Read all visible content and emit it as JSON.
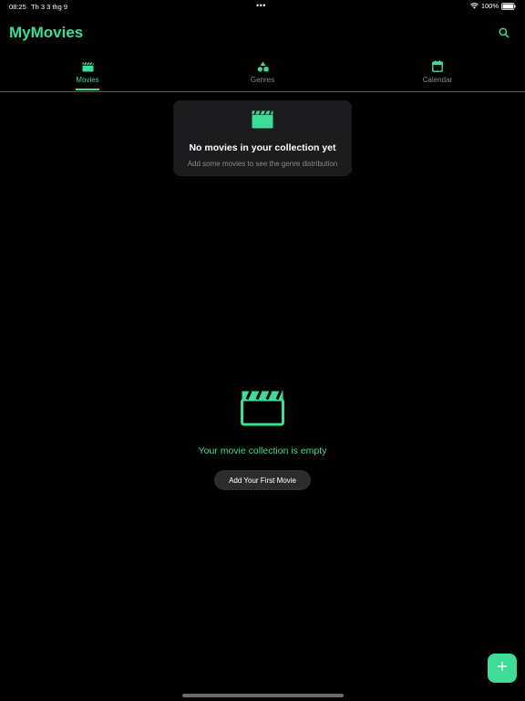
{
  "status_bar": {
    "time": "08:25",
    "date": "Th 3 3 thg 9",
    "dots": "•••",
    "battery": "100%"
  },
  "header": {
    "title": "MyMovies"
  },
  "tabs": [
    {
      "label": "Movies",
      "icon": "clapperboard-icon",
      "active": true
    },
    {
      "label": "Genres",
      "icon": "shapes-icon",
      "active": false
    },
    {
      "label": "Calendar",
      "icon": "calendar-icon",
      "active": false
    }
  ],
  "genre_card": {
    "icon": "clapperboard-icon",
    "title": "No movies in your collection yet",
    "subtitle": "Add some movies to see the genre distribution"
  },
  "empty_state": {
    "icon": "clapperboard-icon",
    "message": "Your movie collection is empty",
    "button_label": "Add Your First Movie"
  },
  "fab": {
    "icon": "plus-icon"
  },
  "colors": {
    "accent": "#3ddc97",
    "background": "#000000",
    "card": "#1c1c1e",
    "muted_text": "#8a8a8a"
  }
}
